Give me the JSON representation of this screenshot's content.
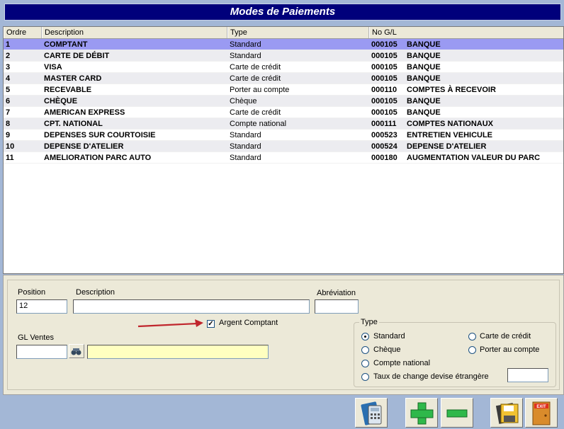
{
  "window": {
    "title": "Modes de Paiements"
  },
  "grid": {
    "columns": [
      "Ordre",
      "Description",
      "Type",
      "No G/L"
    ],
    "rows": [
      {
        "ordre": "1",
        "description": "COMPTANT",
        "type": "Standard",
        "gl": "000105",
        "gl_name": "BANQUE",
        "selected": true
      },
      {
        "ordre": "2",
        "description": "CARTE DE DÉBIT",
        "type": "Standard",
        "gl": "000105",
        "gl_name": "BANQUE"
      },
      {
        "ordre": "3",
        "description": "VISA",
        "type": "Carte de crédit",
        "gl": "000105",
        "gl_name": "BANQUE"
      },
      {
        "ordre": "4",
        "description": "MASTER CARD",
        "type": "Carte de crédit",
        "gl": "000105",
        "gl_name": "BANQUE"
      },
      {
        "ordre": "5",
        "description": "RECEVABLE",
        "type": "Porter au compte",
        "gl": "000110",
        "gl_name": "COMPTES À RECEVOIR"
      },
      {
        "ordre": "6",
        "description": "CHÈQUE",
        "type": "Chèque",
        "gl": "000105",
        "gl_name": "BANQUE"
      },
      {
        "ordre": "7",
        "description": "AMERICAN EXPRESS",
        "type": "Carte de crédit",
        "gl": "000105",
        "gl_name": "BANQUE"
      },
      {
        "ordre": "8",
        "description": "CPT. NATIONAL",
        "type": "Compte national",
        "gl": "000111",
        "gl_name": "COMPTES NATIONAUX"
      },
      {
        "ordre": "9",
        "description": "DEPENSES SUR COURTOISIE",
        "type": "Standard",
        "gl": "000523",
        "gl_name": "ENTRETIEN VEHICULE"
      },
      {
        "ordre": "10",
        "description": "DEPENSE D'ATELIER",
        "type": "Standard",
        "gl": "000524",
        "gl_name": "DEPENSE D'ATELIER"
      },
      {
        "ordre": "11",
        "description": "AMELIORATION PARC AUTO",
        "type": "Standard",
        "gl": "000180",
        "gl_name": "AUGMENTATION VALEUR DU PARC"
      }
    ]
  },
  "form": {
    "position_label": "Position",
    "position_value": "12",
    "description_label": "Description",
    "description_value": "",
    "abreviation_label": "Abréviation",
    "abreviation_value": "",
    "argent_comptant_label": "Argent Comptant",
    "argent_comptant_checked": true,
    "gl_ventes_label": "GL Ventes",
    "gl_ventes_value": "",
    "gl_ventes_name": "",
    "type_group": {
      "title": "Type",
      "options": {
        "standard": "Standard",
        "carte_credit": "Carte de crédit",
        "cheque": "Chèque",
        "porter_compte": "Porter au compte",
        "compte_national": "Compte national",
        "taux_change": "Taux de change devise étrangère"
      },
      "selected": "Standard",
      "taux_value": ""
    }
  },
  "toolbar": {
    "icons": [
      "calculator-icon",
      "plus-icon",
      "minus-icon",
      "save-icon",
      "exit-icon"
    ],
    "exit_text": "EXIT"
  },
  "colors": {
    "title_bg": "#00007b",
    "selected_row": "#9a9af2",
    "background": "#a3b7d6",
    "annotation_arrow": "#c0262d"
  }
}
